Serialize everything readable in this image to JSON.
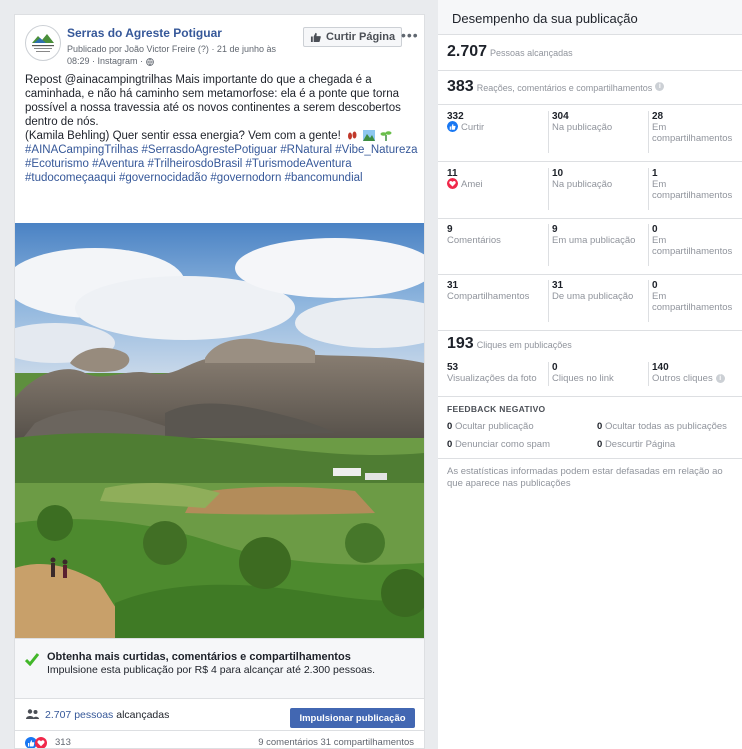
{
  "post": {
    "page_name": "Serras do Agreste Potiguar",
    "meta_line1": "Publicado por João Victor Freire",
    "meta_q": "(?)",
    "meta_date": "· 21 de junho às",
    "meta_line2": "08:29 · Instagram ·",
    "like_page_label": "Curtir Página",
    "more_label": "•••",
    "logo_text": "SERRAS DO AGRESTE POTIGUAR",
    "text_body": "Repost @ainacampingtrilhas Mais importante do que a chegada é a caminhada, e não há caminho sem metamorfose: ela é a ponte que torna possível a nossa travessia até os novos continentes a serem descobertos dentro de nós.",
    "text_credit": "(Kamila Behling) Quer sentir essa energia? Vem com a gente!",
    "hashtags": "#AINACampingTrilhas #SerrasdoAgrestePotiguar #RNatural #Vibe_Natureza #Ecoturismo #Aventura #TrilheirosdoBrasil #TurismodeAventura #tudocomeçaaqui #governocidadão #governodorn #bancomundial"
  },
  "boost": {
    "title": "Obtenha mais curtidas, comentários e compartilhamentos",
    "subtitle": "Impulsione esta publicação por R$ 4 para alcançar até 2.300 pessoas.",
    "button": "Impulsionar publicação"
  },
  "reach": {
    "link": "2.707 pessoas",
    "suffix": " alcançadas"
  },
  "reactions": {
    "count": "313",
    "right": "9 comentários  31 compartilhamentos"
  },
  "panel": {
    "title": "Desempenho da sua publicação",
    "reached_num": "2.707",
    "reached_label": "Pessoas alcançadas",
    "engage_num": "383",
    "engage_label": "Reações, comentários e compartilhamentos",
    "rows": [
      {
        "total": "332",
        "total_label": "Curtir",
        "icon": "like-icon",
        "a": "304",
        "a_label": "Na publicação",
        "b": "28",
        "b_label": "Em compartilhamentos"
      },
      {
        "total": "11",
        "total_label": "Amei",
        "icon": "love-icon",
        "a": "10",
        "a_label": "Na publicação",
        "b": "1",
        "b_label": "Em compartilhamentos"
      },
      {
        "total": "9",
        "total_label": "Comentários",
        "icon": "",
        "a": "9",
        "a_label": "Em uma publicação",
        "b": "0",
        "b_label": "Em compartilhamentos"
      },
      {
        "total": "31",
        "total_label": "Compartilhamentos",
        "icon": "",
        "a": "31",
        "a_label": "De uma publicação",
        "b": "0",
        "b_label": "Em compartilhamentos"
      }
    ],
    "clicks_num": "193",
    "clicks_label": "Cliques em publicações",
    "clicks": [
      {
        "num": "53",
        "label": "Visualizações da foto"
      },
      {
        "num": "0",
        "label": "Cliques no link"
      },
      {
        "num": "140",
        "label": "Outros cliques"
      }
    ],
    "feedback_title": "FEEDBACK NEGATIVO",
    "feedback": [
      {
        "num": "0",
        "label": "Ocultar publicação"
      },
      {
        "num": "0",
        "label": "Ocultar todas as publicações"
      },
      {
        "num": "0",
        "label": "Denunciar como spam"
      },
      {
        "num": "0",
        "label": "Descurtir Página"
      }
    ],
    "disclaimer": "As estatísticas informadas podem estar defasadas em relação ao que aparece nas publicações"
  },
  "colors": {
    "accent": "#4267b2",
    "link": "#365899",
    "love": "#f0284a",
    "like": "#1877f2"
  }
}
